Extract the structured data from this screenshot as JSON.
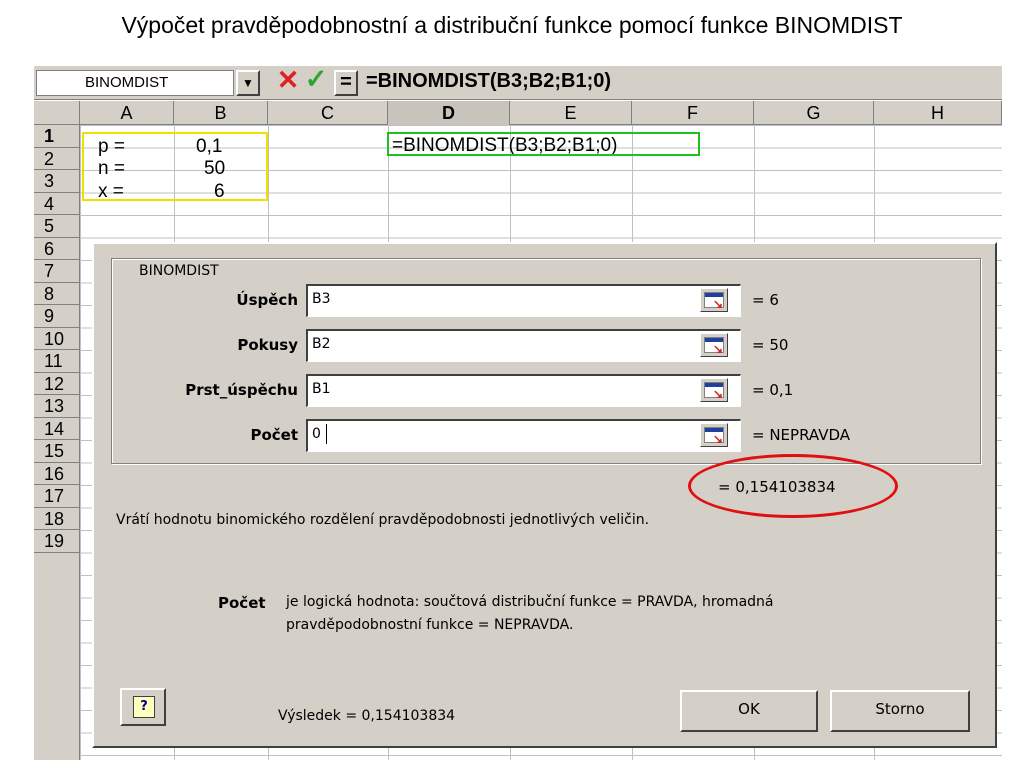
{
  "slide": {
    "title": "Výpočet pravděpodobnostní a distribuční funkce pomocí funkce BINOMDIST"
  },
  "formula_bar": {
    "name_box": "BINOMDIST",
    "dropdown_icon": "chevron-down-icon",
    "cancel_icon": "cancel-x-icon",
    "enter_icon": "check-icon",
    "equal_label": "=",
    "formula": "=BINOMDIST(B3;B2;B1;0)"
  },
  "columns": [
    "A",
    "B",
    "C",
    "D",
    "E",
    "F",
    "G",
    "H"
  ],
  "rows": [
    "1",
    "2",
    "3",
    "4",
    "5",
    "6",
    "7",
    "8",
    "9",
    "10",
    "11",
    "12",
    "13",
    "14",
    "15",
    "16",
    "17",
    "18",
    "19"
  ],
  "cells": {
    "a1": "p  =",
    "b1": "0,1",
    "a2": "n  =",
    "b2": "50",
    "a3": "x  =",
    "b3": "6",
    "d1": "=BINOMDIST(B3;B2;B1;0)"
  },
  "dialog": {
    "group_caption": "BINOMDIST",
    "args": [
      {
        "label": "Úspěch",
        "value": "B3",
        "result": "= 6"
      },
      {
        "label": "Pokusy",
        "value": "B2",
        "result": "= 50"
      },
      {
        "label": "Prst_úspěchu",
        "value": "B1",
        "result": "= 0,1"
      },
      {
        "label": "Počet",
        "value": "0",
        "result": "= NEPRAVDA"
      }
    ],
    "result_value": "= 0,154103834",
    "description": "Vrátí hodnotu binomického rozdělení pravděpodobnosti jednotlivých veličin.",
    "param_name": "Počet",
    "param_desc_line1": "je logická hodnota: součtová distribuční funkce = PRAVDA, hromadná",
    "param_desc_line2": "pravděpodobnostní funkce = NEPRAVDA.",
    "help_label": "?",
    "footer_result": "Výsledek = 0,154103834",
    "ok_label": "OK",
    "cancel_label": "Storno"
  },
  "colors": {
    "highlight_yellow": "#f0e000",
    "highlight_green": "#20c020",
    "highlight_red": "#e01010",
    "dialog_face": "#d4d0c8"
  }
}
